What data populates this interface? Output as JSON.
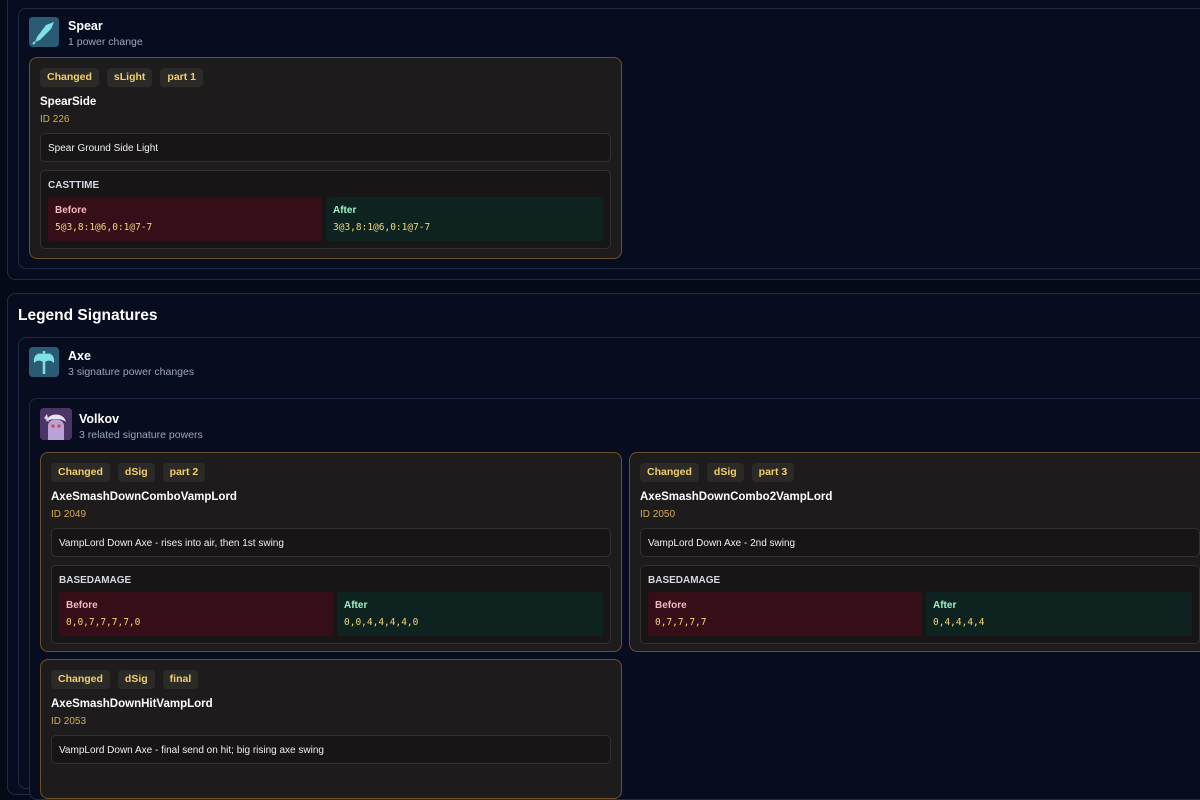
{
  "top_weapon": {
    "name": "Spear",
    "subtitle": "1 power change",
    "icon": "spear-icon",
    "cards": [
      {
        "tags": [
          "Changed",
          "sLight",
          "part 1"
        ],
        "name": "SpearSide",
        "id": "ID 226",
        "description": "Spear Ground Side Light",
        "field": "CASTTIME",
        "before_label": "Before",
        "before_value": "5@3,8:1@6,0:1@7-7",
        "after_label": "After",
        "after_value": "3@3,8:1@6,0:1@7-7"
      }
    ]
  },
  "legend_section": {
    "title": "Legend Signatures",
    "weapon": {
      "name": "Axe",
      "subtitle": "3 signature power changes",
      "icon": "axe-icon"
    },
    "legend": {
      "name": "Volkov",
      "subtitle": "3 related signature powers",
      "icon": "volkov-avatar"
    },
    "cards": [
      {
        "tags": [
          "Changed",
          "dSig",
          "part 2"
        ],
        "name": "AxeSmashDownComboVampLord",
        "id": "ID 2049",
        "description": "VampLord Down Axe - rises into air, then 1st swing",
        "field": "BASEDAMAGE",
        "before_label": "Before",
        "before_value": "0,0,7,7,7,7,0",
        "after_label": "After",
        "after_value": "0,0,4,4,4,4,0"
      },
      {
        "tags": [
          "Changed",
          "dSig",
          "part 3"
        ],
        "name": "AxeSmashDownCombo2VampLord",
        "id": "ID 2050",
        "description": "VampLord Down Axe - 2nd swing",
        "field": "BASEDAMAGE",
        "before_label": "Before",
        "before_value": "0,7,7,7,7",
        "after_label": "After",
        "after_value": "0,4,4,4,4"
      },
      {
        "tags": [
          "Changed",
          "dSig",
          "final"
        ],
        "name": "AxeSmashDownHitVampLord",
        "id": "ID 2053",
        "description": "VampLord Down Axe - final send on hit; big rising axe swing"
      }
    ]
  },
  "colors": {
    "background": "#050a18",
    "card_border": "#6e4f2b",
    "tag_text": "#f2cf6b",
    "before_bg": "#350e17",
    "after_bg": "#0e2320"
  }
}
